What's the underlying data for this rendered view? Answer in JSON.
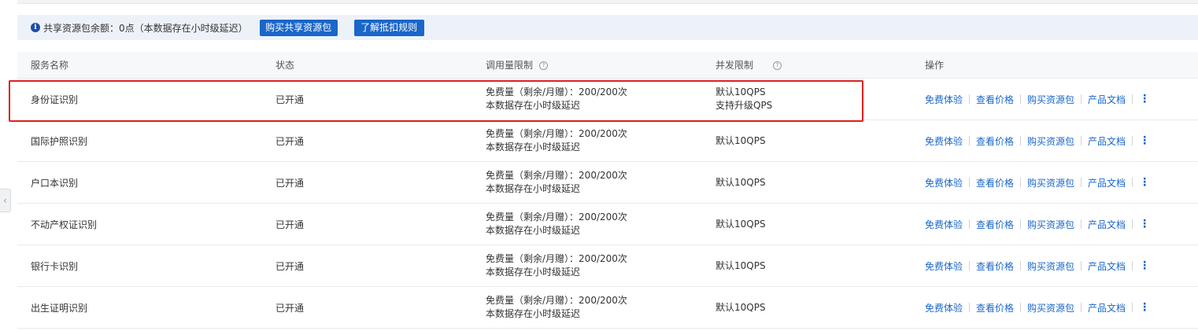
{
  "notice": {
    "text": "共享资源包余额：0点（本数据存在小时级延迟）",
    "buy_button": "购买共享资源包",
    "rules_button": "了解抵扣规则"
  },
  "table": {
    "headers": {
      "name": "服务名称",
      "status": "状态",
      "quota": "调用量限制",
      "qps": "并发限制",
      "ops": "操作"
    },
    "ops_labels": {
      "trial": "免费体验",
      "price": "查看价格",
      "buy": "购买资源包",
      "docs": "产品文档"
    },
    "rows": [
      {
        "name": "身份证识别",
        "status": "已开通",
        "quota_line1": "免费量（剩余/月赠）：200/200次",
        "quota_line2": "本数据存在小时级延迟",
        "qps_line1": "默认10QPS",
        "qps_line2": "支持升级QPS"
      },
      {
        "name": "国际护照识别",
        "status": "已开通",
        "quota_line1": "免费量（剩余/月赠）：200/200次",
        "quota_line2": "本数据存在小时级延迟",
        "qps_line1": "默认10QPS",
        "qps_line2": ""
      },
      {
        "name": "户口本识别",
        "status": "已开通",
        "quota_line1": "免费量（剩余/月赠）：200/200次",
        "quota_line2": "本数据存在小时级延迟",
        "qps_line1": "默认10QPS",
        "qps_line2": ""
      },
      {
        "name": "不动产权证识别",
        "status": "已开通",
        "quota_line1": "免费量（剩余/月赠）：200/200次",
        "quota_line2": "本数据存在小时级延迟",
        "qps_line1": "默认10QPS",
        "qps_line2": ""
      },
      {
        "name": "银行卡识别",
        "status": "已开通",
        "quota_line1": "免费量（剩余/月赠）：200/200次",
        "quota_line2": "本数据存在小时级延迟",
        "qps_line1": "默认10QPS",
        "qps_line2": ""
      },
      {
        "name": "出生证明识别",
        "status": "已开通",
        "quota_line1": "免费量（剩余/月赠）：200/200次",
        "quota_line2": "本数据存在小时级延迟",
        "qps_line1": "默认10QPS",
        "qps_line2": ""
      }
    ]
  },
  "icons": {
    "info": "info-circle-icon",
    "help": "question-circle-icon",
    "more": "more-vertical-icon",
    "collapse": "chevron-left-icon"
  },
  "colors": {
    "primary": "#1a66c9",
    "highlight": "#e02020",
    "notice_bg": "#edf2f9"
  }
}
